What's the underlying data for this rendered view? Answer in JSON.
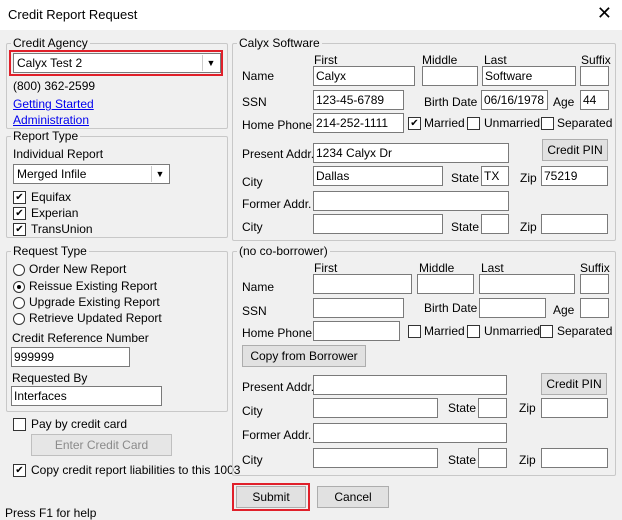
{
  "window": {
    "title": "Credit Report Request",
    "close_glyph": "✕"
  },
  "agency": {
    "legend": "Credit Agency",
    "selected": "Calyx Test 2",
    "phone": "(800) 362-2599",
    "links": [
      "Getting Started",
      "Administration"
    ]
  },
  "report_type": {
    "legend": "Report Type",
    "individual_label": "Individual Report",
    "selected": "Merged Infile",
    "bureaus": [
      {
        "label": "Equifax",
        "checked": true
      },
      {
        "label": "Experian",
        "checked": true
      },
      {
        "label": "TransUnion",
        "checked": true
      }
    ]
  },
  "request_type": {
    "legend": "Request Type",
    "options": [
      {
        "label": "Order New Report",
        "selected": false
      },
      {
        "label": "Reissue Existing Report",
        "selected": true
      },
      {
        "label": "Upgrade Existing Report",
        "selected": false
      },
      {
        "label": "Retrieve Updated Report",
        "selected": false
      }
    ],
    "ref_label": "Credit Reference Number",
    "ref_value": "999999",
    "requested_by_label": "Requested By",
    "requested_by_value": "Interfaces"
  },
  "payment": {
    "pay_label": "Pay by credit card",
    "pay_checked": false,
    "enter_card_label": "Enter Credit Card",
    "copy_label": "Copy credit report liabilities to this 1003",
    "copy_checked": true
  },
  "labels": {
    "first": "First",
    "middle": "Middle",
    "last": "Last",
    "suffix": "Suffix",
    "name": "Name",
    "ssn": "SSN",
    "birth_date": "Birth Date",
    "age": "Age",
    "home_phone": "Home Phone",
    "married": "Married",
    "unmarried": "Unmarried",
    "separated": "Separated",
    "present_addr": "Present Addr.",
    "city": "City",
    "state": "State",
    "zip": "Zip",
    "former_addr": "Former Addr.",
    "credit_pin": "Credit PIN"
  },
  "borrower": {
    "legend": "Calyx  Software",
    "first": "Calyx",
    "middle": "",
    "last": "Software",
    "suffix": "",
    "ssn": "123-45-6789",
    "birth_date": "06/16/1978",
    "age": "44",
    "home_phone": "214-252-1111",
    "married": true,
    "unmarried": false,
    "separated": false,
    "present_addr": "1234 Calyx Dr",
    "city": "Dallas",
    "state": "TX",
    "zip": "75219",
    "former_addr": "",
    "former_city": "",
    "former_state": "",
    "former_zip": ""
  },
  "coborrower": {
    "legend": "(no co-borrower)",
    "copy_from_label": "Copy from Borrower",
    "first": "",
    "middle": "",
    "last": "",
    "suffix": "",
    "ssn": "",
    "birth_date": "",
    "age": "",
    "home_phone": "",
    "married": false,
    "unmarried": false,
    "separated": false,
    "present_addr": "",
    "city": "",
    "state": "",
    "zip": "",
    "former_addr": "",
    "former_city": "",
    "former_state": "",
    "former_zip": ""
  },
  "footer": {
    "help": "Press F1 for help",
    "submit": "Submit",
    "cancel": "Cancel"
  },
  "highlight_color": "#e0202a"
}
